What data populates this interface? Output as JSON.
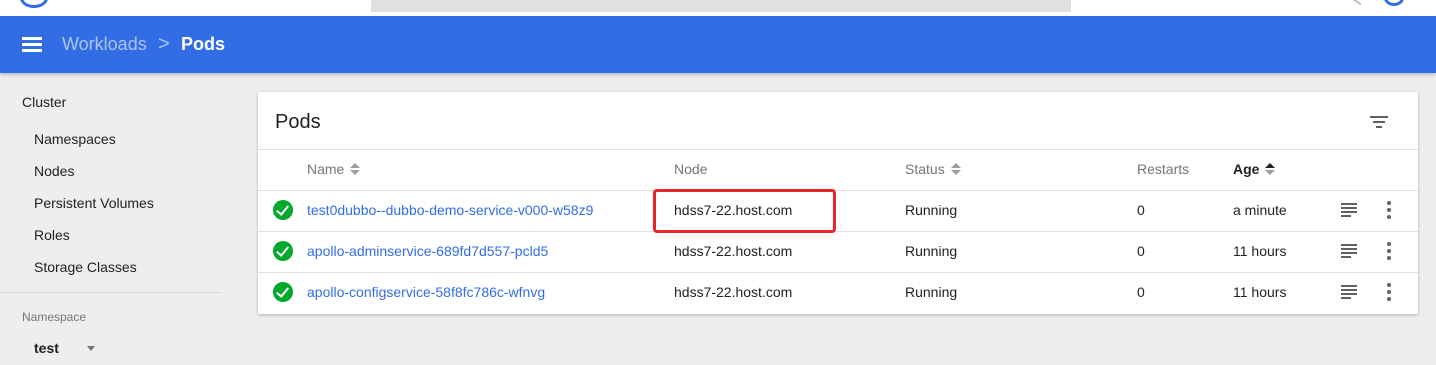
{
  "toolbar": {
    "breadcrumb_parent": "Workloads",
    "breadcrumb_separator": ">",
    "breadcrumb_current": "Pods",
    "background_color": "#326de6"
  },
  "sidebar": {
    "cluster_heading": "Cluster",
    "items": [
      {
        "label": "Namespaces"
      },
      {
        "label": "Nodes"
      },
      {
        "label": "Persistent Volumes"
      },
      {
        "label": "Roles"
      },
      {
        "label": "Storage Classes"
      }
    ],
    "namespace_label": "Namespace",
    "namespace_value": "test"
  },
  "pods_card": {
    "title": "Pods",
    "columns": {
      "name": "Name",
      "node": "Node",
      "status": "Status",
      "restarts": "Restarts",
      "age": "Age"
    },
    "rows": [
      {
        "name": "test0dubbo--dubbo-demo-service-v000-w58z9",
        "node": "hdss7-22.host.com",
        "status": "Running",
        "restarts": "0",
        "age": "a minute"
      },
      {
        "name": "apollo-adminservice-689fd7d557-pcld5",
        "node": "hdss7-22.host.com",
        "status": "Running",
        "restarts": "0",
        "age": "11 hours"
      },
      {
        "name": "apollo-configservice-58f8fc786c-wfnvg",
        "node": "hdss7-22.host.com",
        "status": "Running",
        "restarts": "0",
        "age": "11 hours"
      }
    ]
  },
  "colors": {
    "accent": "#326de6",
    "status_ok": "#00a82b",
    "highlight": "#e8252a"
  },
  "icons": [
    "menu-icon",
    "filter-icon",
    "check-circle-icon",
    "logs-icon",
    "more-vert-icon",
    "sort-icon",
    "dropdown-caret-icon"
  ]
}
